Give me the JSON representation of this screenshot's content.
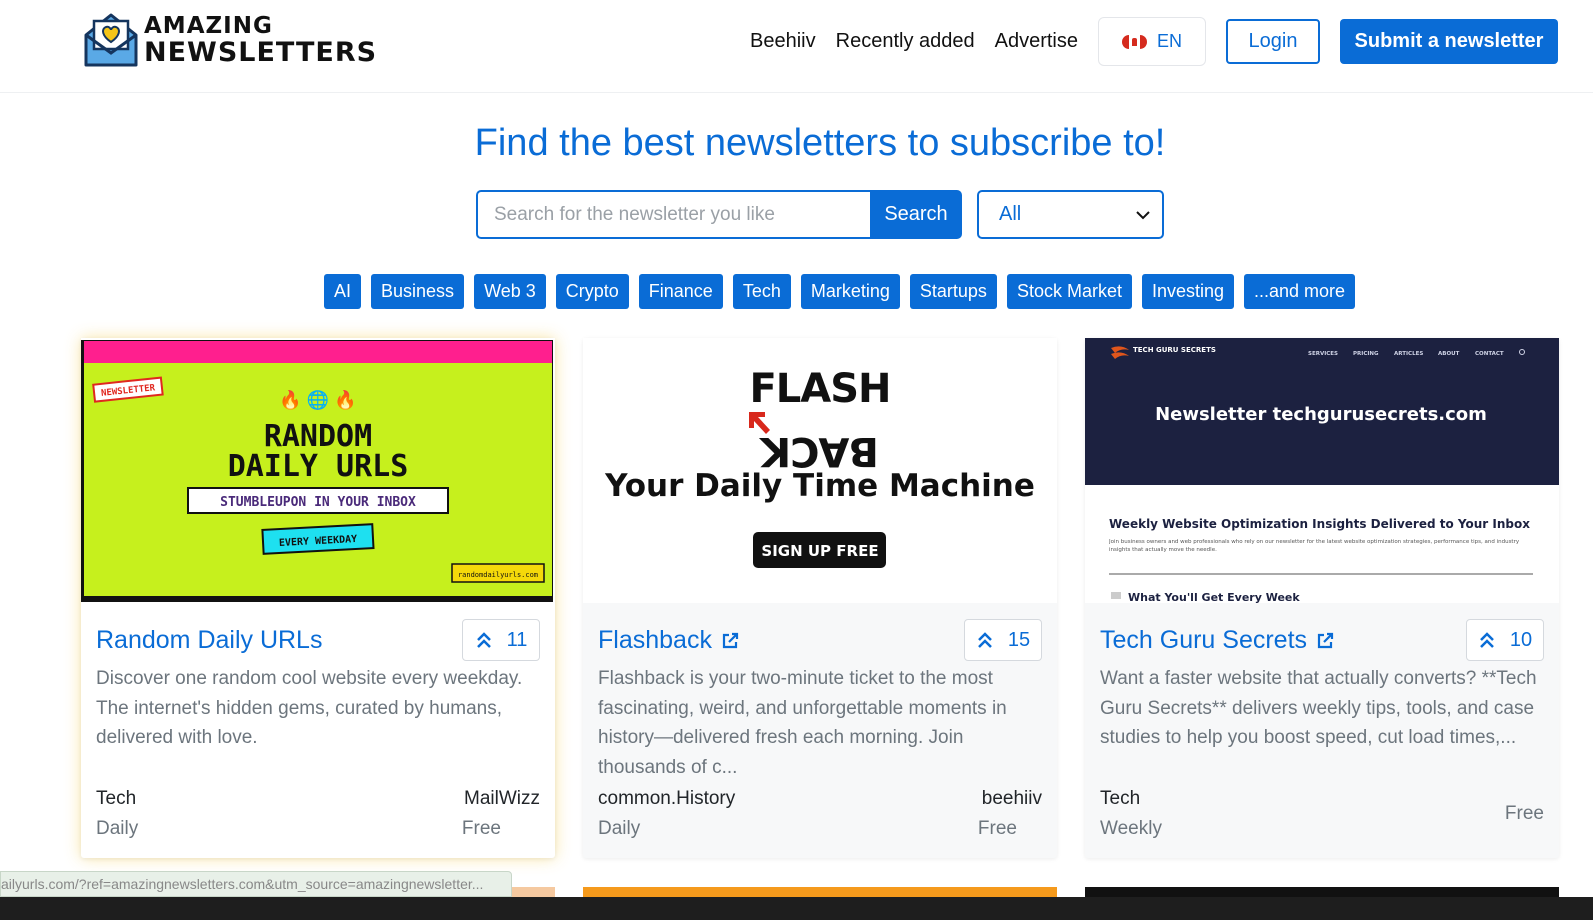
{
  "header": {
    "logo_line1": "AMAZING",
    "logo_line2": "NEWSLETTERS",
    "nav": [
      "Beehiiv",
      "Recently added",
      "Advertise"
    ],
    "language": "EN",
    "login": "Login",
    "submit": "Submit a newsletter"
  },
  "hero": {
    "title": "Find the best newsletters to subscribe to!",
    "search_placeholder": "Search for the newsletter you like",
    "search_button": "Search",
    "filter_selected": "All"
  },
  "tags": [
    "AI",
    "Business",
    "Web 3",
    "Crypto",
    "Finance",
    "Tech",
    "Marketing",
    "Startups",
    "Stock Market",
    "Investing",
    "...and more"
  ],
  "cards": [
    {
      "title": "Random Daily URLs",
      "votes": "11",
      "description": "Discover one random cool website every weekday. The internet's hidden gems, curated by humans, delivered with love.",
      "category": "Tech",
      "platform": "MailWizz",
      "frequency": "Daily",
      "price": "Free",
      "image": {
        "badge": "NEWSLETTER",
        "emojis": "🔥 🌐 🔥",
        "line1": "RANDOM",
        "line2": "DAILY URLS",
        "tagline": "STUMBLEUPON IN YOUR INBOX",
        "pill": "EVERY WEEKDAY",
        "domain": "randomdailyurls.com"
      }
    },
    {
      "title": "Flashback",
      "votes": "15",
      "description": "Flashback is your two-minute ticket to the most fascinating, weird, and unforgettable moments in history—delivered fresh each morning. Join thousands of c...",
      "category": "common.History",
      "platform": "beehiiv",
      "frequency": "Daily",
      "price": "Free",
      "image": {
        "logo_top": "FLASH",
        "logo_bottom": "BACK",
        "headline": "Your Daily Time Machine",
        "cta": "SIGN UP FREE"
      }
    },
    {
      "title": "Tech Guru Secrets",
      "votes": "10",
      "description": "Want a faster website that actually converts? **Tech Guru Secrets** delivers weekly tips, tools, and case studies to help you boost speed, cut load times,...",
      "category": "Tech",
      "platform": "",
      "frequency": "Weekly",
      "price": "Free",
      "image": {
        "brand": "TECH GURU SECRETS",
        "menu": [
          "SERVICES",
          "PRICING",
          "ARTICLES",
          "ABOUT",
          "CONTACT"
        ],
        "banner": "Newsletter techgurusecrets.com",
        "heading": "Weekly Website Optimization Insights Delivered to Your Inbox",
        "body": "Join business owners and web professionals who rely on our newsletter for the latest website optimization strategies, performance tips, and industry insights that actually move the needle.",
        "subheading": "What You'll Get Every Week"
      }
    }
  ],
  "status_url": "ailyurls.com/?ref=amazingnewsletters.com&utm_source=amazingnewsletter...",
  "colors": {
    "primary": "#0a6cd6",
    "muted": "#6c757d"
  }
}
